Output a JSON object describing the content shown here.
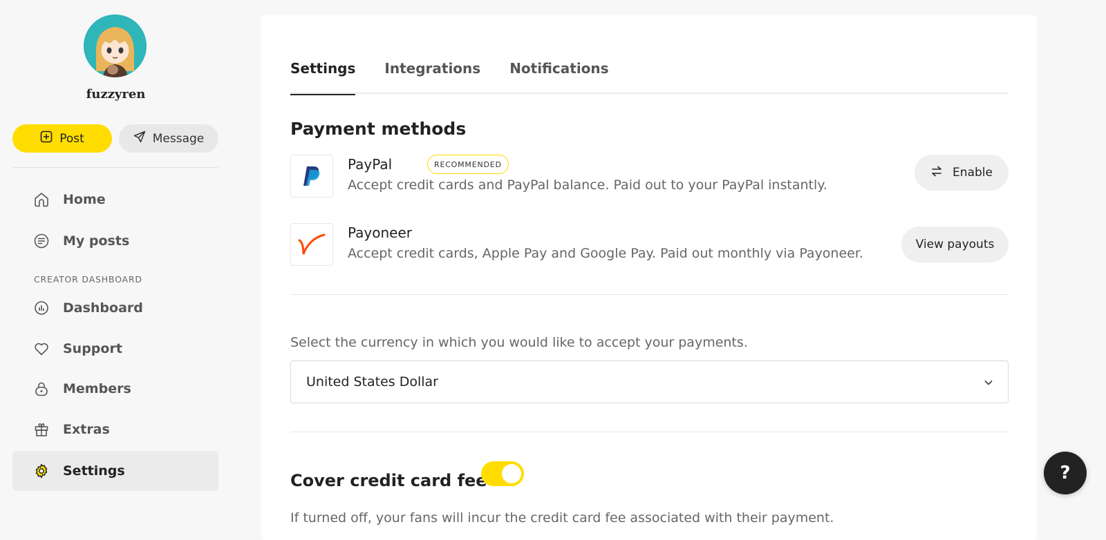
{
  "profile": {
    "username": "fuzzyren",
    "avatar_icon": "avatar-anime-girl"
  },
  "actions": {
    "post_label": "Post",
    "message_label": "Message"
  },
  "nav": {
    "home": "Home",
    "my_posts": "My posts",
    "section_label": "CREATOR DASHBOARD",
    "dashboard": "Dashboard",
    "support": "Support",
    "members": "Members",
    "extras": "Extras",
    "settings": "Settings"
  },
  "tabs": [
    {
      "label": "Settings",
      "active": true
    },
    {
      "label": "Integrations",
      "active": false
    },
    {
      "label": "Notifications",
      "active": false
    }
  ],
  "payment": {
    "heading": "Payment methods",
    "paypal": {
      "name": "PayPal",
      "badge": "RECOMMENDED",
      "description": "Accept credit cards and PayPal balance. Paid out to your PayPal instantly.",
      "button": "Enable"
    },
    "payoneer": {
      "name": "Payoneer",
      "description": "Accept credit cards, Apple Pay and Google Pay. Paid out monthly via Payoneer.",
      "button": "View payouts"
    }
  },
  "currency": {
    "label": "Select the currency in which you would like to accept your payments.",
    "selected": "United States Dollar"
  },
  "fee": {
    "title": "Cover credit card fee",
    "enabled": true,
    "description": "If turned off, your fans will incur the credit card fee associated with their payment."
  },
  "help": {
    "label": "?"
  },
  "colors": {
    "accent": "#ffdd00",
    "dark": "#222222"
  }
}
